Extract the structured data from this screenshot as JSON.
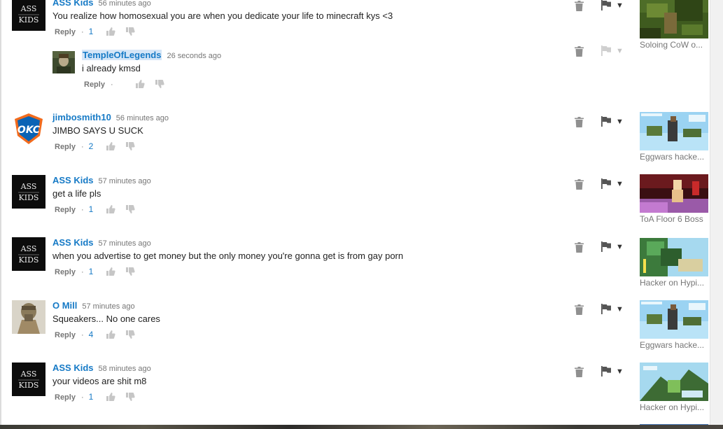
{
  "comments": [
    {
      "author": "ASS Kids",
      "time": "56 minutes ago",
      "text": "You realize how homosexual you are when you dedicate your life to minecraft kys <3",
      "reply_label": "Reply",
      "likes": "1",
      "video_title": "Soloing CoW o..."
    },
    {
      "author": "TempleOfLegends",
      "time": "26 seconds ago",
      "text": "i already kmsd",
      "reply_label": "Reply",
      "likes": ""
    },
    {
      "author": "jimbosmith10",
      "time": "56 minutes ago",
      "text": "JIMBO SAYS U SUCK",
      "reply_label": "Reply",
      "likes": "2",
      "video_title": "Eggwars hacke..."
    },
    {
      "author": "ASS Kids",
      "time": "57 minutes ago",
      "text": "get a life pls",
      "reply_label": "Reply",
      "likes": "1",
      "video_title": "ToA Floor 6 Boss"
    },
    {
      "author": "ASS Kids",
      "time": "57 minutes ago",
      "text": "when you advertise to get money but the only money you're gonna get is from gay porn",
      "reply_label": "Reply",
      "likes": "1",
      "video_title": "Hacker on Hypi..."
    },
    {
      "author": "O Mill",
      "time": "57 minutes ago",
      "text": "Squeakers... No one cares",
      "reply_label": "Reply",
      "likes": "4",
      "video_title": "Eggwars hacke..."
    },
    {
      "author": "ASS Kids",
      "time": "58 minutes ago",
      "text": "your videos are shit m8",
      "reply_label": "Reply",
      "likes": "1",
      "video_title": "Hacker on Hypi..."
    }
  ],
  "avatar_text": {
    "line1": "ASS",
    "line2": "KIDS",
    "okc": "OKC"
  },
  "icons": {
    "remove": "trash-icon",
    "flag": "flag-icon",
    "menu": "caret-down-icon",
    "like": "thumbs-up-icon",
    "dislike": "thumbs-down-icon"
  },
  "colors": {
    "link": "#167ac6",
    "muted": "#767676",
    "highlight": "#d5e6f7"
  }
}
